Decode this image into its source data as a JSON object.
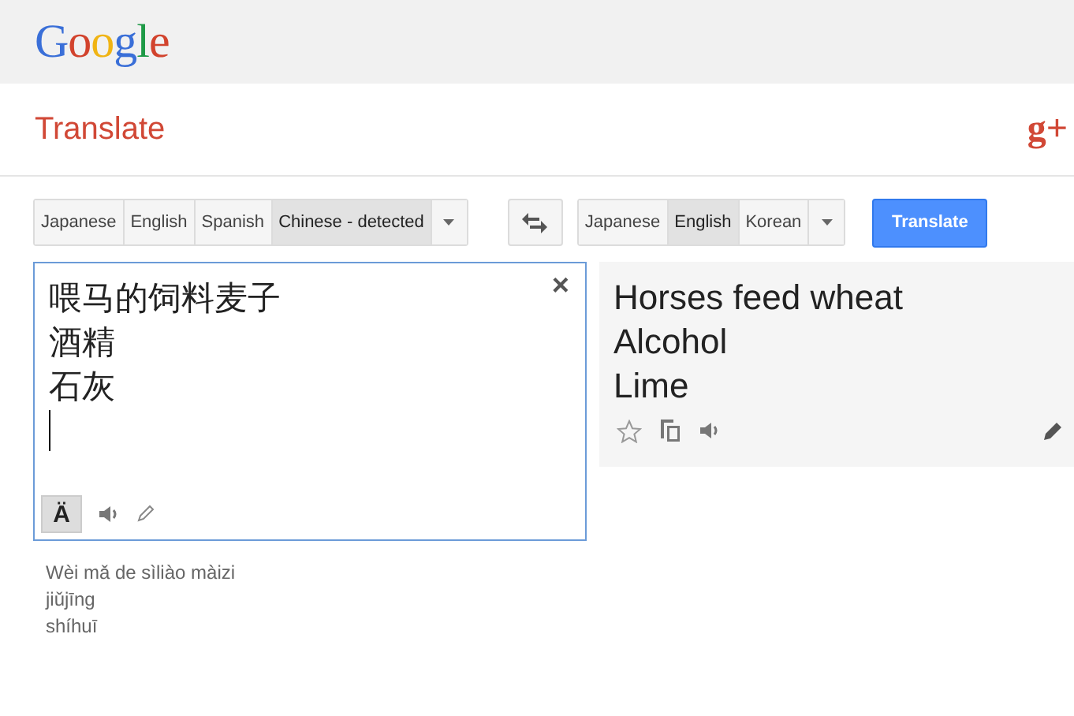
{
  "header": {
    "logo": "Google"
  },
  "bar": {
    "title": "Translate",
    "social": "g+"
  },
  "source_languages": [
    {
      "label": "Japanese",
      "selected": false
    },
    {
      "label": "English",
      "selected": false
    },
    {
      "label": "Spanish",
      "selected": false
    },
    {
      "label": "Chinese - detected",
      "selected": true
    }
  ],
  "target_languages": [
    {
      "label": "Japanese",
      "selected": false
    },
    {
      "label": "English",
      "selected": true
    },
    {
      "label": "Korean",
      "selected": false
    }
  ],
  "translate_button": "Translate",
  "source": {
    "lines": [
      "喂马的饲料麦子",
      "酒精",
      "石灰"
    ],
    "close": "×",
    "keyboard": "Ä",
    "keyboard_on": true
  },
  "result": {
    "lines": [
      "Horses feed wheat",
      "Alcohol",
      "Lime"
    ]
  },
  "romanization": [
    "Wèi mǎ de sìliào màizi",
    "jiǔjīng",
    "shíhuī"
  ]
}
